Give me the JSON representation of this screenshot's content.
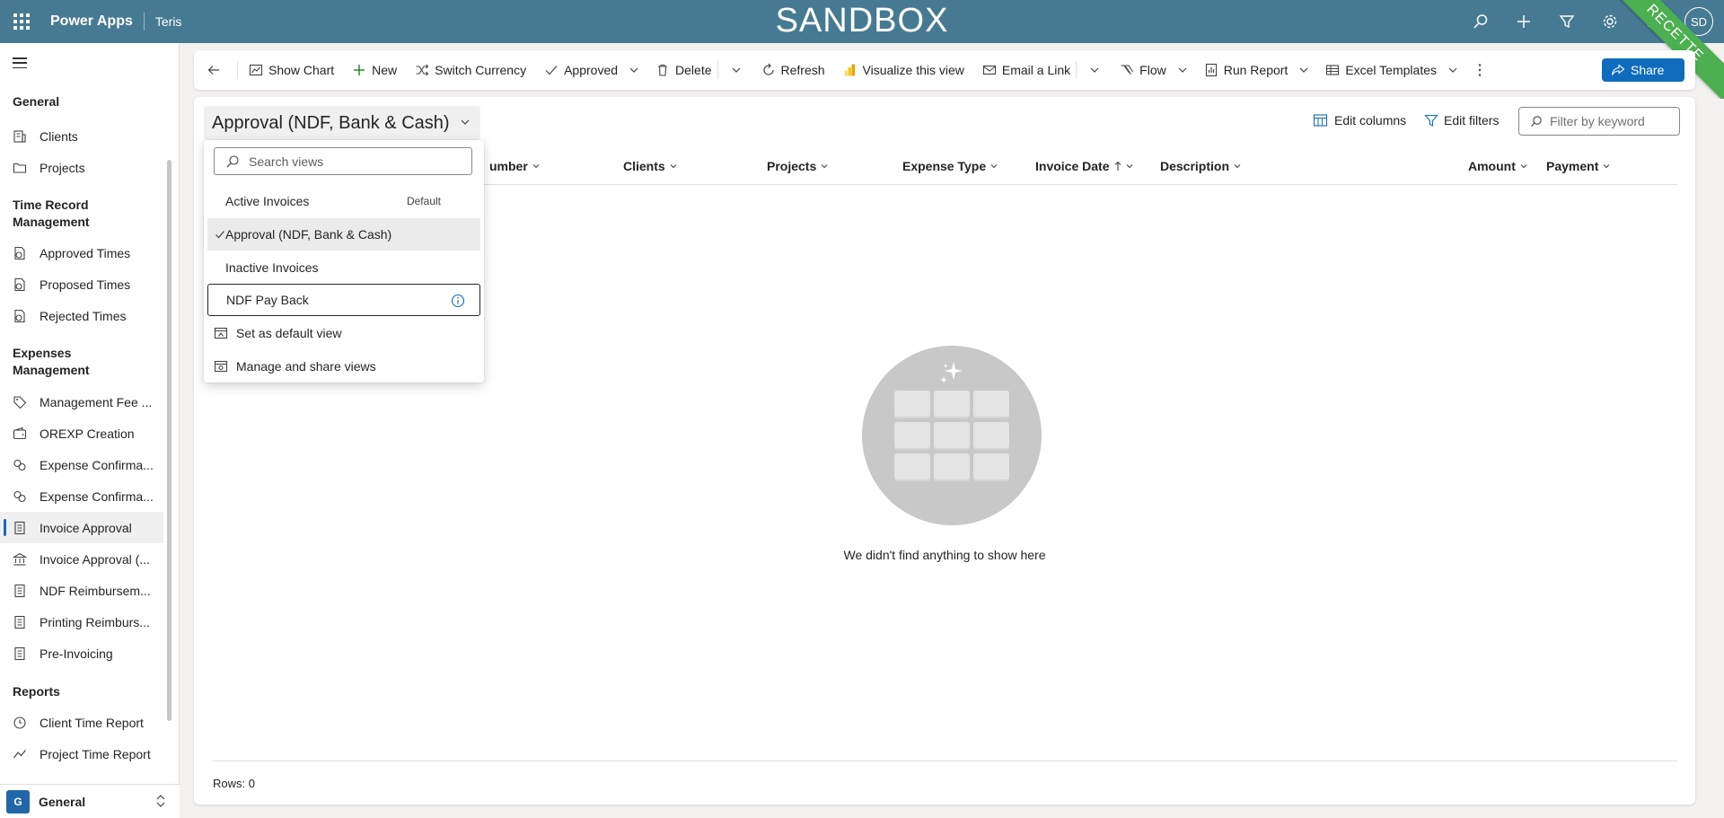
{
  "header": {
    "app_name": "Power Apps",
    "env_name": "Teris",
    "banner": "SANDBOX",
    "user_initials": "SD",
    "ribbon": "RECETTE",
    "bar_color": "#467a93"
  },
  "sidebar": {
    "groups": [
      {
        "title": "General",
        "items": [
          "Clients",
          "Projects"
        ]
      },
      {
        "title": "Time Record Management",
        "items": [
          "Approved Times",
          "Proposed Times",
          "Rejected Times"
        ]
      },
      {
        "title": "Expenses Management",
        "items": [
          "Management Fee ...",
          "OREXP Creation",
          "Expense Confirma...",
          "Expense Confirma...",
          "Invoice Approval",
          "Invoice Approval (...",
          "NDF Reimbursem...",
          "Printing Reimburs...",
          "Pre-Invoicing"
        ]
      },
      {
        "title": "Reports",
        "items": [
          "Client Time Report",
          "Project Time Report"
        ]
      }
    ],
    "selected_item": "Invoice Approval",
    "area": {
      "badge": "G",
      "label": "General"
    }
  },
  "commandbar": {
    "show_chart": "Show Chart",
    "new": "New",
    "switch_currency": "Switch Currency",
    "approved": "Approved",
    "delete": "Delete",
    "refresh": "Refresh",
    "visualize": "Visualize this view",
    "email_link": "Email a Link",
    "flow": "Flow",
    "run_report": "Run Report",
    "excel_templates": "Excel Templates",
    "share": "Share"
  },
  "view": {
    "current": "Approval (NDF, Bank & Cash)",
    "edit_columns": "Edit columns",
    "edit_filters": "Edit filters",
    "filter_placeholder": "Filter by keyword"
  },
  "grid": {
    "columns": [
      "umber",
      "Clients",
      "Projects",
      "Expense Type",
      "Invoice Date",
      "Description",
      "Amount",
      "Payment"
    ],
    "empty_message": "We didn't find anything to show here",
    "rows_label": "Rows: 0"
  },
  "flyout": {
    "search_placeholder": "Search views",
    "views": [
      {
        "label": "Active Invoices",
        "tag": "Default"
      },
      {
        "label": "Approval (NDF, Bank & Cash)",
        "tag": ""
      },
      {
        "label": "Inactive Invoices",
        "tag": ""
      },
      {
        "label": "NDF Pay Back",
        "tag": ""
      }
    ],
    "set_default": "Set as default view",
    "manage_share": "Manage and share views"
  }
}
